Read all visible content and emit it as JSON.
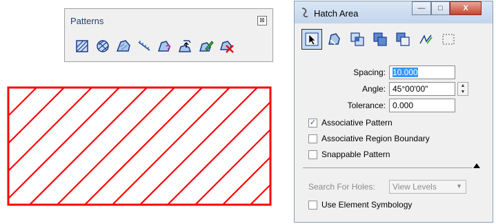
{
  "patterns_toolbar": {
    "title": "Patterns",
    "close_glyph": "⊠",
    "tools": [
      "hatch-area-icon",
      "crosshatch-area-icon",
      "pattern-area-icon",
      "linear-pattern-icon",
      "show-pattern-attributes-icon",
      "match-pattern-attributes-icon",
      "change-pattern-icon",
      "delete-pattern-icon"
    ]
  },
  "hatch_dialog": {
    "title": "Hatch Area",
    "window_buttons": {
      "minimize": "—",
      "maximize": "□",
      "close": "X"
    },
    "methods": [
      "element-icon",
      "fence-icon",
      "intersection-icon",
      "union-icon",
      "difference-icon",
      "points-icon",
      "flood-icon"
    ],
    "spacing": {
      "label": "Spacing:",
      "value": "10.000"
    },
    "angle": {
      "label": "Angle:",
      "value": "45°00'00\""
    },
    "tolerance": {
      "label": "Tolerance:",
      "value": "0.000"
    },
    "associative_pattern": {
      "label": "Associative Pattern",
      "checked": true
    },
    "associative_region_boundary": {
      "label": "Associative Region Boundary",
      "checked": false
    },
    "snappable_pattern": {
      "label": "Snappable Pattern",
      "checked": false
    },
    "search_for_holes": {
      "label": "Search For Holes:",
      "value": "View Levels"
    },
    "use_element_symbology": {
      "label": "Use Element Symbology",
      "checked": false
    }
  },
  "colors": {
    "hatch": "#ff0000",
    "dialog_bg": "#f0f0f0",
    "selection": "#3399ff"
  }
}
